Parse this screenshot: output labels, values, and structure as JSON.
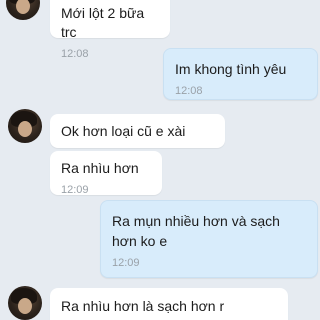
{
  "messages": [
    {
      "dir": "in",
      "text": "Mới lột 2 bữa trc",
      "time": "12:08"
    },
    {
      "dir": "out",
      "text": "Im khong tình yêu",
      "time": "12:08"
    },
    {
      "dir": "in",
      "text": "Ok hơn loại cũ e xài",
      "time": ""
    },
    {
      "dir": "in",
      "text": "Ra nhìu hơn",
      "time": "12:09"
    },
    {
      "dir": "out",
      "text": "Ra mụn nhiều hơn và sạch hơn ko e",
      "time": "12:09"
    },
    {
      "dir": "in",
      "text": "Ra nhìu hơn là sạch hơn r",
      "time": ""
    }
  ]
}
